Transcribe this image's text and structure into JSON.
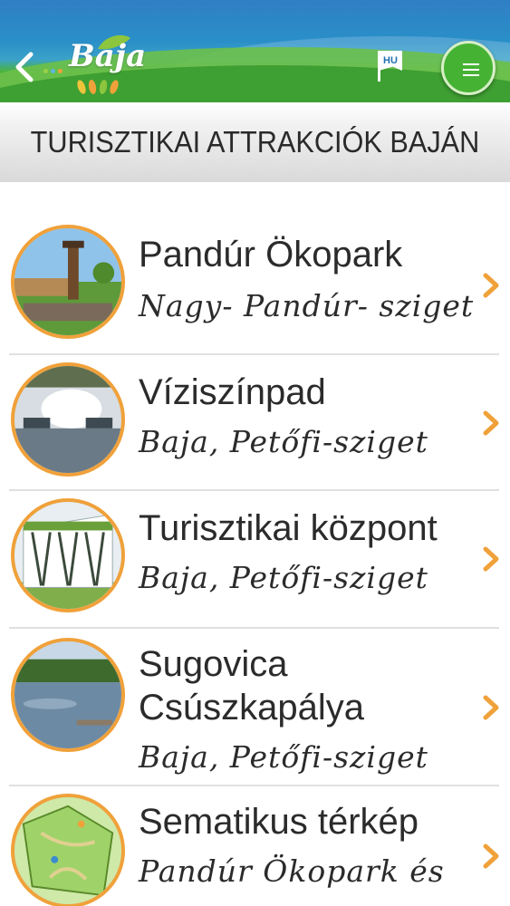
{
  "header": {
    "logo_text": "Baja",
    "language_label": "HU",
    "back_icon": "chevron-left-icon",
    "menu_icon": "hamburger-icon"
  },
  "page_title": "TURISZTIKAI ATTRAKCIÓK BAJÁN",
  "colors": {
    "accent_orange": "#f0a13a",
    "header_green": "#45b233",
    "header_blue": "#2f7fc4"
  },
  "attractions": [
    {
      "title": "Pandúr Ökopark",
      "subtitle": "Nagy- Pandúr- sziget"
    },
    {
      "title": "Víziszínpad",
      "subtitle": "Baja, Petőfi-sziget"
    },
    {
      "title": "Turisztikai központ",
      "subtitle": "Baja, Petőfi-sziget"
    },
    {
      "title_line1": "Sugovica",
      "title_line2": "Csúszkapálya",
      "subtitle": "Baja, Petőfi-sziget"
    },
    {
      "title": "Sematikus térkép",
      "subtitle": "Pandúr Ökopark és"
    }
  ]
}
